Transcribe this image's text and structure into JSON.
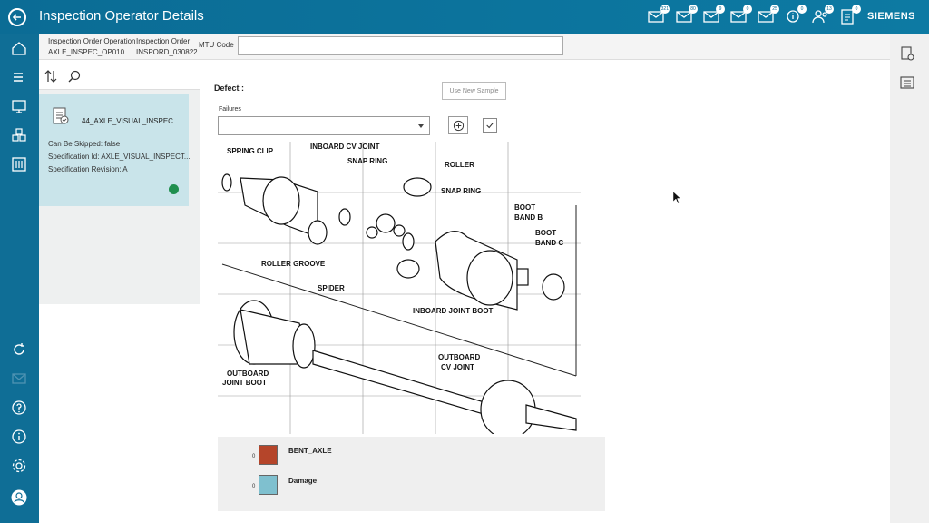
{
  "app": {
    "title": "Inspection Operator Details",
    "brand": "SIEMENS"
  },
  "notifications": [
    {
      "icon": "mail-list-icon",
      "count": "321"
    },
    {
      "icon": "mail-icon",
      "count": "80"
    },
    {
      "icon": "mail-icon",
      "count": "9"
    },
    {
      "icon": "mail-icon",
      "count": "0"
    },
    {
      "icon": "mail-icon",
      "count": "25"
    },
    {
      "icon": "info-hand-icon",
      "count": "0"
    },
    {
      "icon": "workers-icon",
      "count": "13"
    },
    {
      "icon": "document-icon",
      "count": "0"
    }
  ],
  "info": {
    "op_label": "Inspection Order Operation",
    "op_value": "AXLE_INSPEC_OP010",
    "order_label": "Inspection Order",
    "order_value": "INSPORD_030822",
    "mtu_label": "MTU Code",
    "mtu_value": ""
  },
  "card": {
    "title": "44_AXLE_VISUAL_INSPEC",
    "skip": "Can Be Skipped: false",
    "spec_id": "Specification Id: AXLE_VISUAL_INSPECT...",
    "spec_rev": "Specification Revision: A",
    "status_color": "#1f8f4e"
  },
  "defect": {
    "label": "Defect :",
    "use_new_sample": "Use New Sample",
    "failures_label": "Failures",
    "failures_value": ""
  },
  "diagram_labels": {
    "spring_clip": "SPRING CLIP",
    "inboard_cv": "INBOARD CV JOINT",
    "snap_ring_1": "SNAP RING",
    "roller": "ROLLER",
    "snap_ring_2": "SNAP RING",
    "boot_band_b_1": "BOOT",
    "boot_band_b_2": "BAND B",
    "boot_band_c_1": "BOOT",
    "boot_band_c_2": "BAND C",
    "roller_groove": "ROLLER GROOVE",
    "spider": "SPIDER",
    "inboard_boot": "INBOARD JOINT BOOT",
    "outboard_boot_1": "OUTBOARD",
    "outboard_boot_2": "JOINT BOOT",
    "outboard_cv_1": "OUTBOARD",
    "outboard_cv_2": "CV JOINT"
  },
  "legend": [
    {
      "count": "0",
      "name": "BENT_AXLE",
      "color": "#b5452a"
    },
    {
      "count": "0",
      "name": "Damage",
      "color": "#7fc0cf"
    }
  ]
}
